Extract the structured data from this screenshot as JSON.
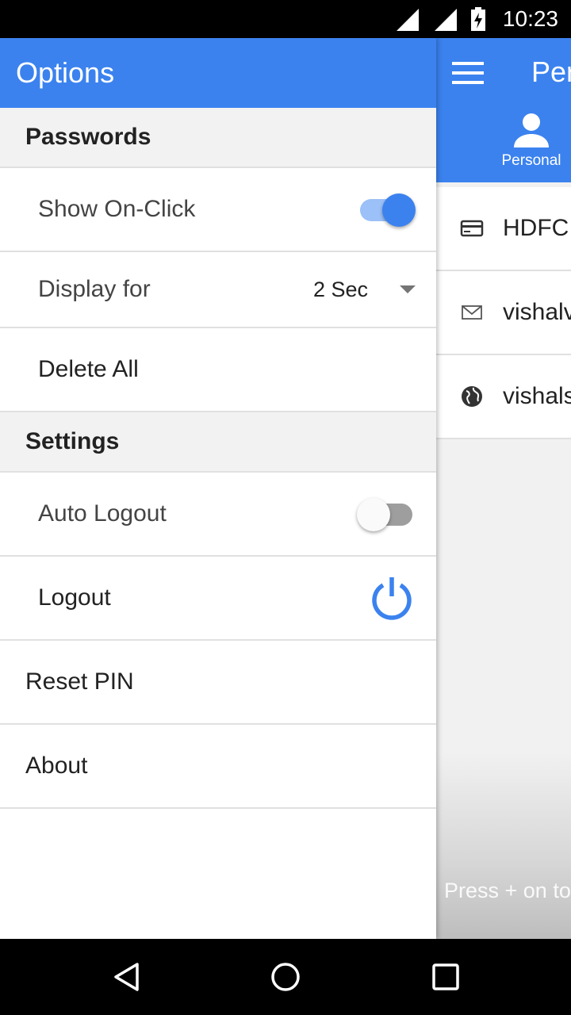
{
  "status_bar": {
    "time": "10:23"
  },
  "background_app": {
    "title": "Per",
    "tab_label": "Personal",
    "items": [
      {
        "icon": "credit-card-icon",
        "text": "HDFC"
      },
      {
        "icon": "email-icon",
        "text": "vishalv"
      },
      {
        "icon": "globe-icon",
        "text": "vishals"
      }
    ],
    "hint": "Press + on to"
  },
  "drawer": {
    "title": "Options",
    "passwords_section": {
      "title": "Passwords",
      "show_on_click_label": "Show On-Click",
      "show_on_click_enabled": true,
      "display_for_label": "Display for",
      "display_for_value": "2 Sec",
      "delete_all_label": "Delete All"
    },
    "settings_section": {
      "title": "Settings",
      "auto_logout_label": "Auto Logout",
      "auto_logout_enabled": false,
      "logout_label": "Logout"
    },
    "reset_pin_label": "Reset PIN",
    "about_label": "About"
  },
  "colors": {
    "primary": "#3b82ef",
    "switch_track_on": "#9cc0f8",
    "divider": "#e0e0e0"
  }
}
